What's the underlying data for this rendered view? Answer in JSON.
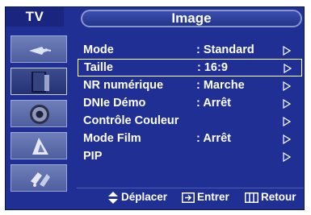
{
  "header": {
    "tv_label": "TV",
    "title": "Image"
  },
  "sidebar": {
    "items": [
      {
        "icon": "antenna-icon",
        "active": false
      },
      {
        "icon": "picture-icon",
        "active": true
      },
      {
        "icon": "speaker-icon",
        "active": false
      },
      {
        "icon": "clock-icon",
        "active": false
      },
      {
        "icon": "setup-icon",
        "active": false
      }
    ]
  },
  "menu": {
    "items": [
      {
        "label": "Mode",
        "value": ": Standard",
        "selected": false
      },
      {
        "label": "Taille",
        "value": ": 16:9",
        "selected": true
      },
      {
        "label": "NR numérique",
        "value": ": Marche",
        "selected": false
      },
      {
        "label": "DNIe Démo",
        "value": ": Arrêt",
        "selected": false
      },
      {
        "label": "Contrôle Couleur",
        "value": "",
        "selected": false
      },
      {
        "label": "Mode Film",
        "value": ": Arrêt",
        "selected": false
      },
      {
        "label": "PIP",
        "value": "",
        "selected": false
      }
    ]
  },
  "footer": {
    "move_label": "Déplacer",
    "enter_label": "Entrer",
    "return_label": "Retour"
  },
  "colors": {
    "background": "#1f2f93",
    "sidebar_icon": "#5e6eab",
    "text": "#ffffff"
  }
}
